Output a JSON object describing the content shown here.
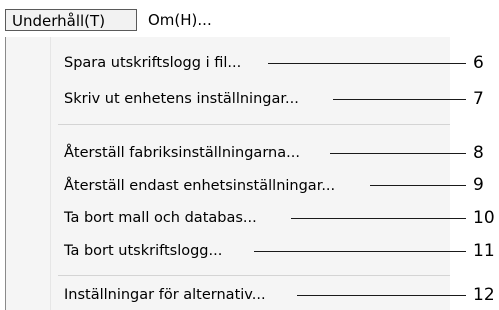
{
  "menubar": {
    "active_menu": "Underhåll(T)",
    "other_menu": "Om(H)..."
  },
  "menu_items": [
    {
      "label": "Spara utskriftslogg i fil...",
      "callout": "6"
    },
    {
      "label": "Skriv ut enhetens inställningar...",
      "callout": "7"
    },
    {
      "label": "Återställ fabriksinställningarna...",
      "callout": "8"
    },
    {
      "label": "Återställ endast enhetsinställningar...",
      "callout": "9"
    },
    {
      "label": "Ta bort mall och databas...",
      "callout": "10"
    },
    {
      "label": "Ta bort utskriftslogg...",
      "callout": "11"
    },
    {
      "label": "Inställningar för alternativ...",
      "callout": "12"
    }
  ]
}
